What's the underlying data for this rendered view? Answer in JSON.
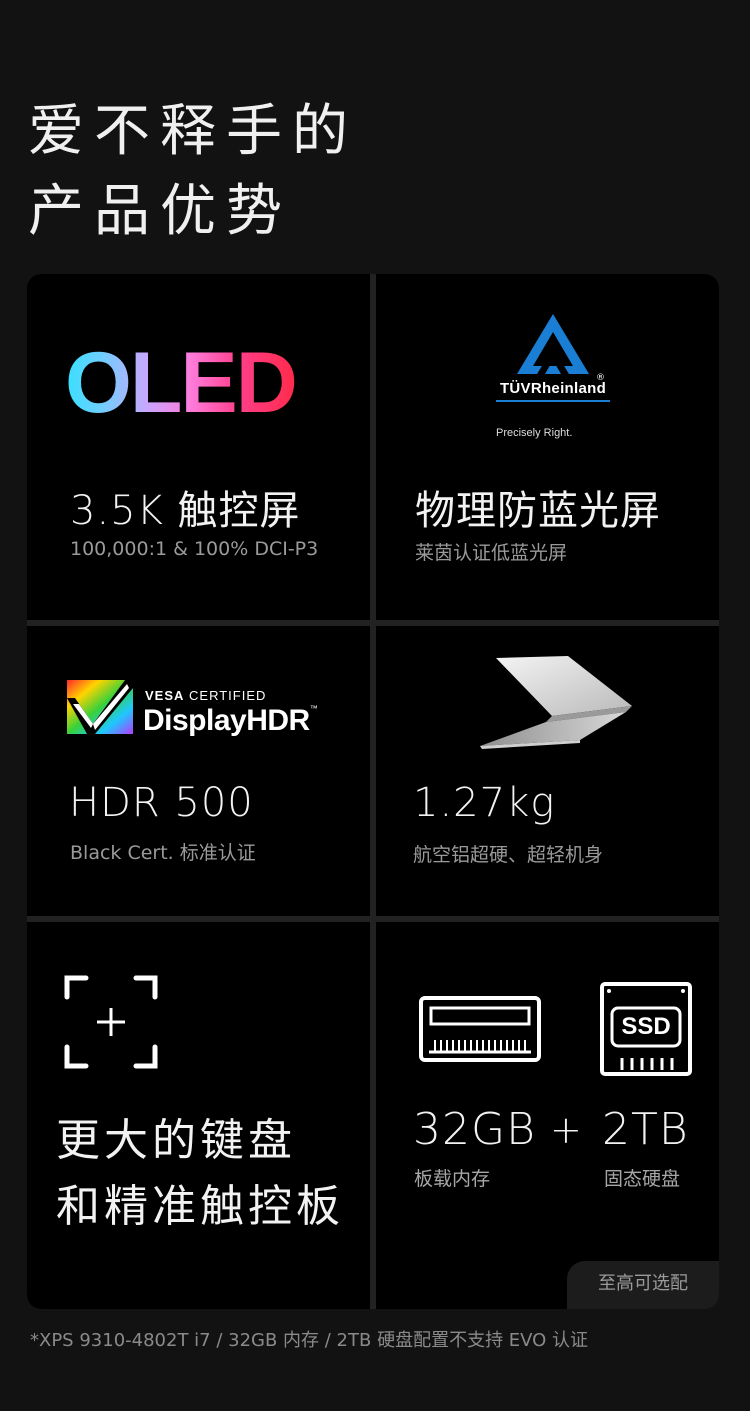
{
  "headline": {
    "line1": "爱不释手的",
    "line2": "产品优势"
  },
  "cards": {
    "oled": {
      "logo_text": "OLED",
      "title": "3.5K 触控屏",
      "subtitle": "100,000:1 & 100% DCI-P3"
    },
    "tuv": {
      "logo_text": "TÜVRheinland",
      "registered": "®",
      "slogan": "Precisely Right.",
      "title": "物理防蓝光屏",
      "subtitle": "莱茵认证低蓝光屏"
    },
    "hdr": {
      "vesa_bold": "VESA",
      "vesa_light": "CERTIFIED",
      "displayhdr": "DisplayHDR",
      "tm": "™",
      "title": "HDR 500",
      "subtitle": "Black Cert. 标准认证"
    },
    "weight": {
      "title": "1.27kg",
      "subtitle": "航空铝超硬、超轻机身",
      "icon": "laptop-icon"
    },
    "keyboard": {
      "line1": "更大的键盘",
      "line2": "和精准触控板",
      "icon": "touchpad-focus-icon"
    },
    "storage": {
      "ram": "32GB",
      "plus": "+",
      "ssd": "2TB",
      "ram_label": "板载内存",
      "ssd_label": "固态硬盘",
      "ssd_icon_text": "SSD",
      "tag": "至高可选配"
    }
  },
  "footnote": "*XPS 9310-4802T i7 / 32GB 内存 / 2TB 硬盘配置不支持 EVO 认证",
  "colors": {
    "background": "#121212",
    "card": "#000000",
    "tuv_blue": "#1a7fd4"
  }
}
